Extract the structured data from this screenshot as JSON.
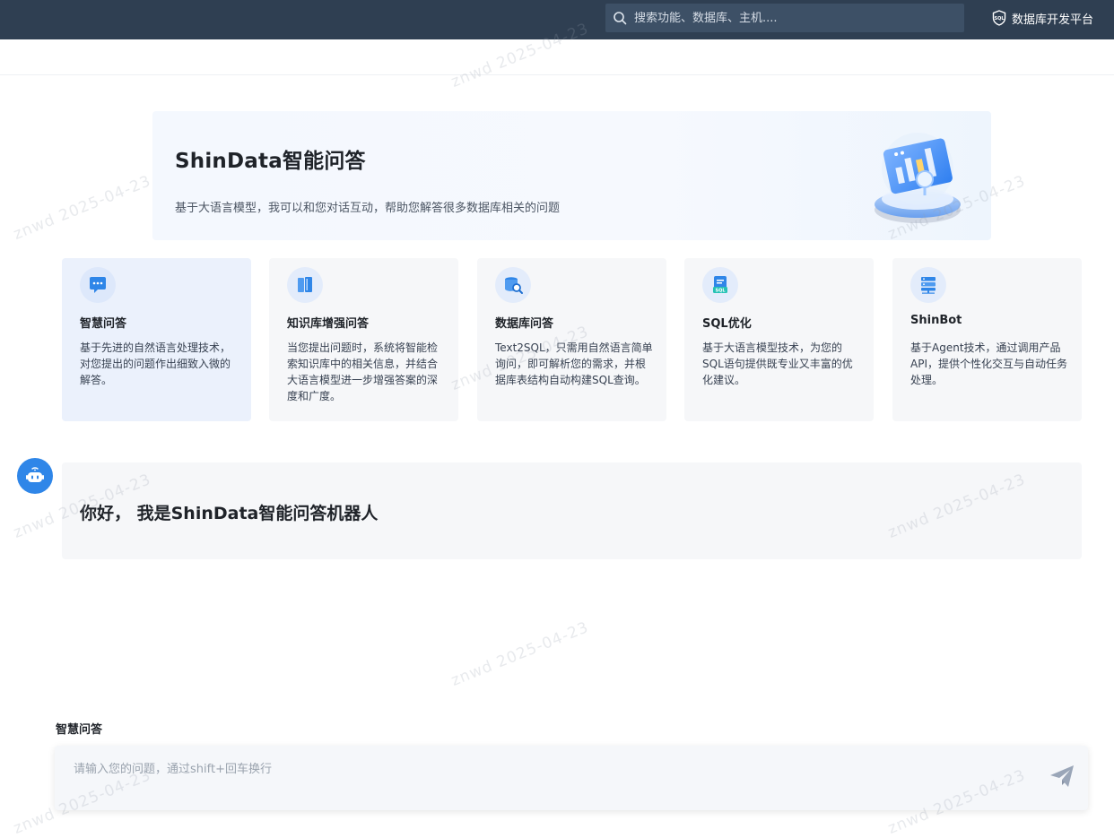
{
  "header": {
    "search_placeholder": "搜索功能、数据库、主机....",
    "platform_label": "数据库开发平台"
  },
  "banner": {
    "title": "ShinData智能问答",
    "subtitle": "基于大语言模型，我可以和您对话互动，帮助您解答很多数据库相关的问题"
  },
  "cards": [
    {
      "title": "智慧问答",
      "desc": "基于先进的自然语言处理技术，对您提出的问题作出细致入微的解答。",
      "icon": "chat-bubble-icon",
      "active": true
    },
    {
      "title": "知识库增强问答",
      "desc": "当您提出问题时，系统将智能检索知识库中的相关信息，并结合大语言模型进一步增强答案的深度和广度。",
      "icon": "book-icon",
      "active": false
    },
    {
      "title": "数据库问答",
      "desc": "Text2SQL，只需用自然语言简单询问，即可解析您的需求，并根据库表结构自动构建SQL查询。",
      "icon": "database-search-icon",
      "active": false
    },
    {
      "title": "SQL优化",
      "desc": "基于大语言模型技术，为您的SQL语句提供既专业又丰富的优化建议。",
      "icon": "sql-doc-icon",
      "active": false
    },
    {
      "title": "ShinBot",
      "desc": "基于Agent技术，通过调用产品API，提供个性化交互与自动任务处理。",
      "icon": "server-stack-icon",
      "active": false
    }
  ],
  "chat": {
    "greeting": "你好， 我是ShinData智能问答机器人"
  },
  "composer": {
    "mode_label": "智慧问答",
    "placeholder": "请输入您的问题，通过shift+回车换行"
  },
  "watermark": "znwd  2025-04-23",
  "colors": {
    "topbar": "#2f3f52",
    "accent": "#2f86e8",
    "card_bg": "#f6f7f9",
    "card_active_bg": "#ebf1fc"
  }
}
